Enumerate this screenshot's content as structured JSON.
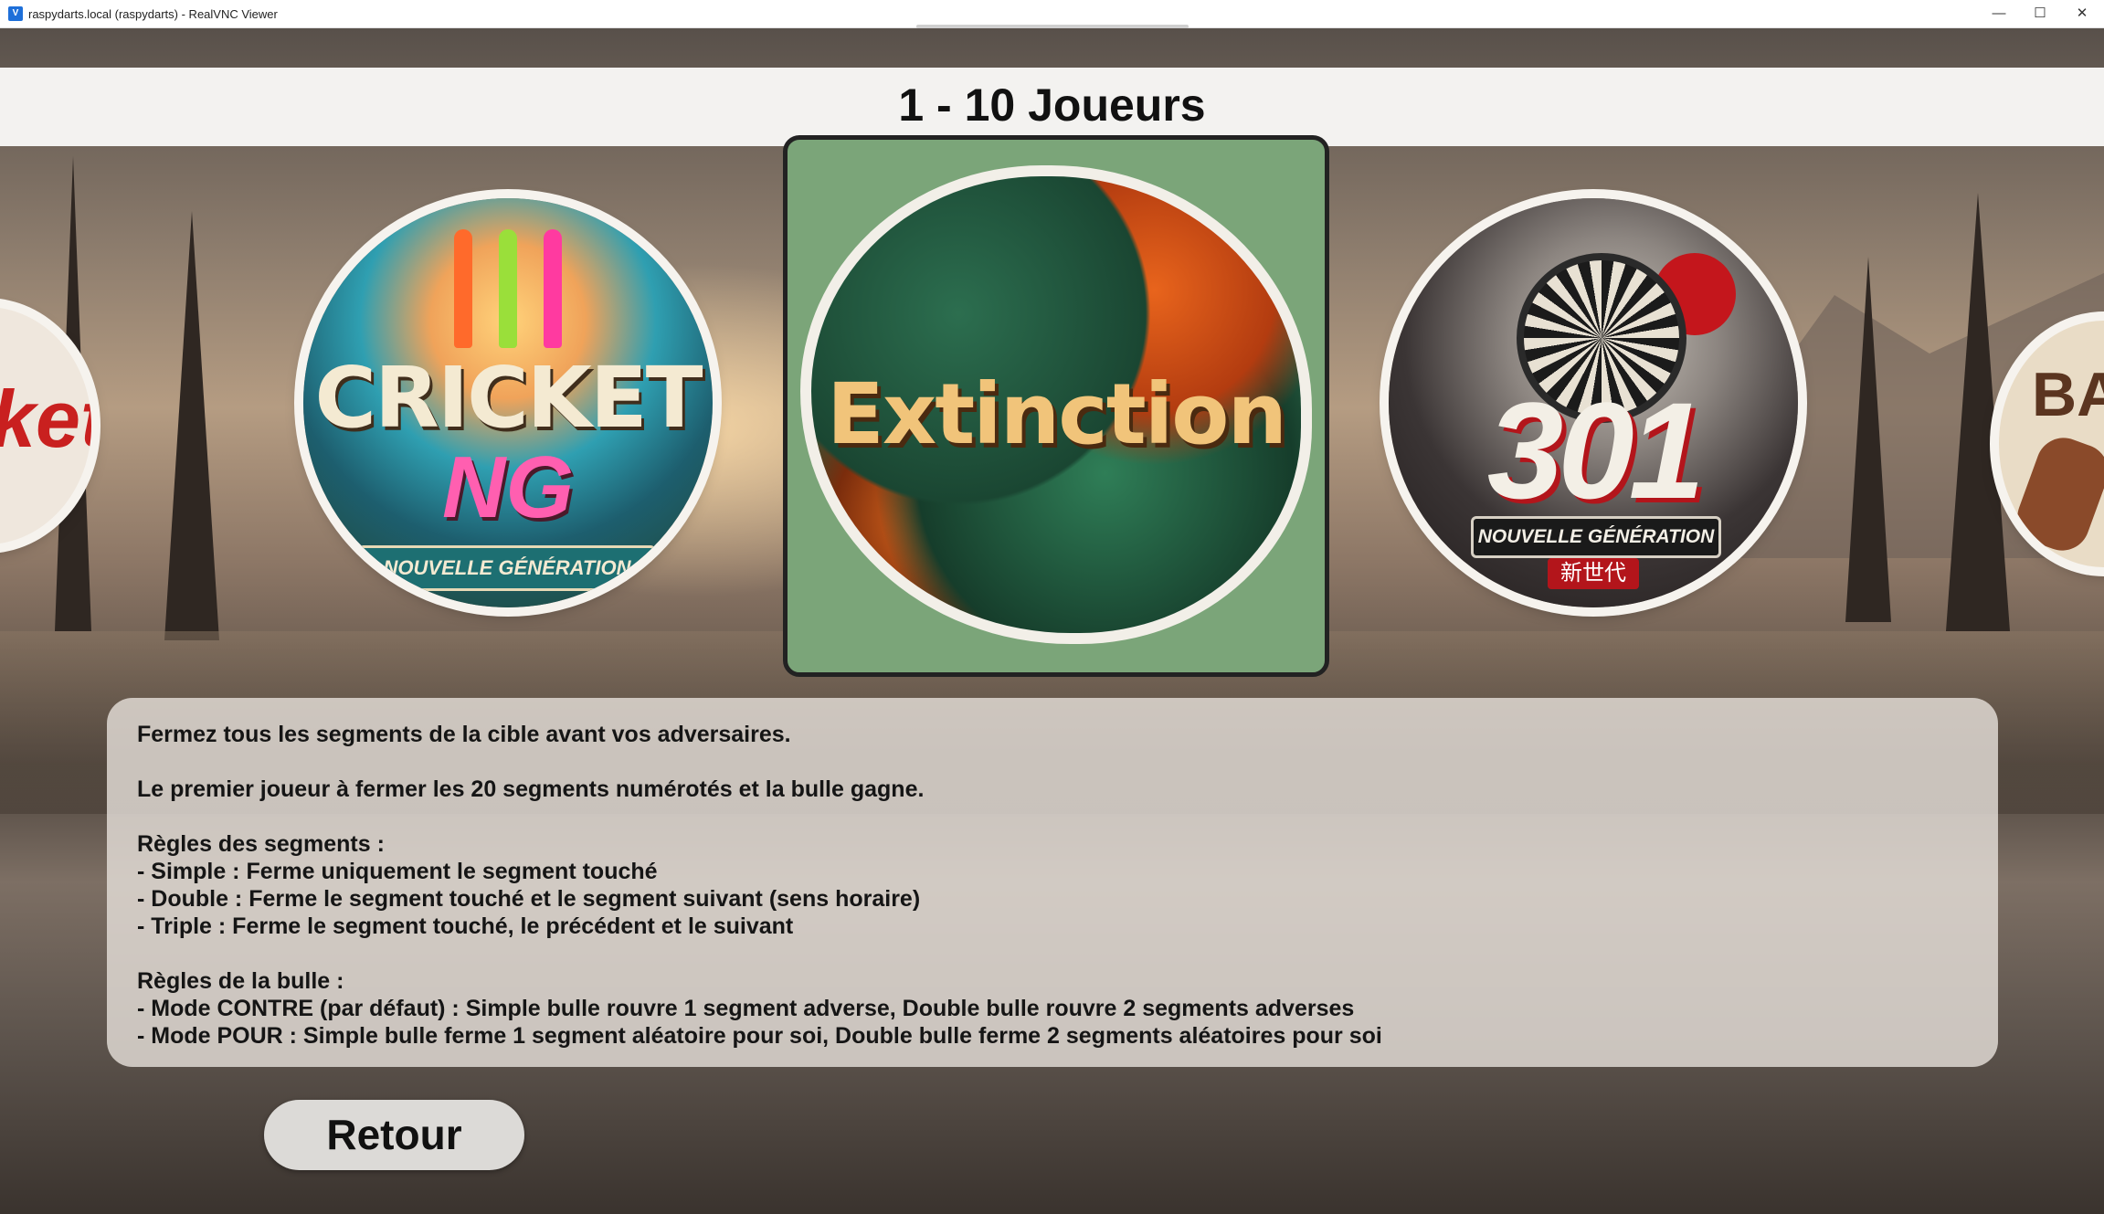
{
  "window": {
    "title": "raspydarts.local (raspydarts) - RealVNC Viewer",
    "icon": "realvnc-icon",
    "controls": {
      "minimize": "—",
      "maximize": "☐",
      "close": "✕"
    }
  },
  "header": {
    "players": "1 - 10 Joueurs"
  },
  "games": {
    "left_partial": {
      "label": "ket"
    },
    "cricket": {
      "line1": "CRICKET",
      "line2": "NG",
      "ribbon": "NOUVELLE GÉNÉRATION"
    },
    "selected": {
      "label": "Extinction"
    },
    "x301": {
      "number": "301",
      "ribbon": "NOUVELLE GÉNÉRATION",
      "kanji": "新世代"
    },
    "right_partial": {
      "label": "BA"
    }
  },
  "rules": {
    "lines": [
      "Fermez tous les segments de la cible avant vos adversaires.",
      "",
      "Le premier joueur à fermer les 20 segments numérotés et la bulle gagne.",
      "",
      "Règles des segments :",
      "- Simple : Ferme uniquement le segment touché",
      "- Double : Ferme le segment touché et le segment suivant (sens horaire)",
      "- Triple : Ferme le segment touché, le précédent et le suivant",
      "",
      "Règles de la bulle :",
      "- Mode CONTRE (par défaut) : Simple bulle rouvre 1 segment adverse, Double bulle rouvre 2 segments adverses",
      "- Mode POUR : Simple bulle ferme 1 segment aléatoire pour soi, Double bulle ferme 2 segments aléatoires pour soi"
    ]
  },
  "footer": {
    "back_label": "Retour"
  }
}
